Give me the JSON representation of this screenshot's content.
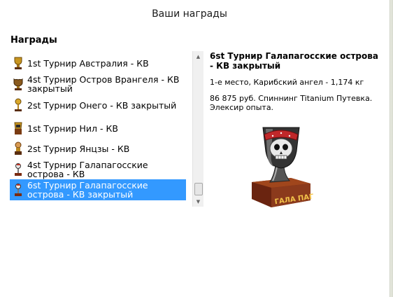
{
  "dialog": {
    "title": "Ваши награды"
  },
  "awards_section": {
    "title": "Награды",
    "items": [
      {
        "label": "1st Турнир Австралия - КВ",
        "icon": "trophy-icon"
      },
      {
        "label": "4st Турнир Остров Врангеля - КВ закрытый",
        "icon": "trophy-icon"
      },
      {
        "label": "2st Турнир Онего - КВ закрытый",
        "icon": "trophy-icon"
      },
      {
        "label": "1st Турнир Нил - КВ",
        "icon": "trophy-icon"
      },
      {
        "label": "2st Турнир Янцзы - КВ",
        "icon": "trophy-icon"
      },
      {
        "label": "4st Турнир Галапагосские острова - КВ",
        "icon": "trophy-icon"
      },
      {
        "label": "6st Турнир Галапагосские острова - КВ закрытый",
        "icon": "trophy-icon",
        "selected": true
      }
    ]
  },
  "detail": {
    "title": "6st Турнир Галапагосские острова - КВ закрытый",
    "place_info": "1-е место, Карибский ангел - 1,174 кг",
    "prize_info": "86 875 руб. Спиннинг Titanium Путевка. Элексир опыта.",
    "trophy_text": "ГАЛА ПАГОСЫ",
    "trophy_icon": "pirate-skull-trophy-icon"
  },
  "colors": {
    "selection": "#3399ff",
    "trophy_base": "#8b3a1c",
    "trophy_text": "#f2c24a"
  }
}
